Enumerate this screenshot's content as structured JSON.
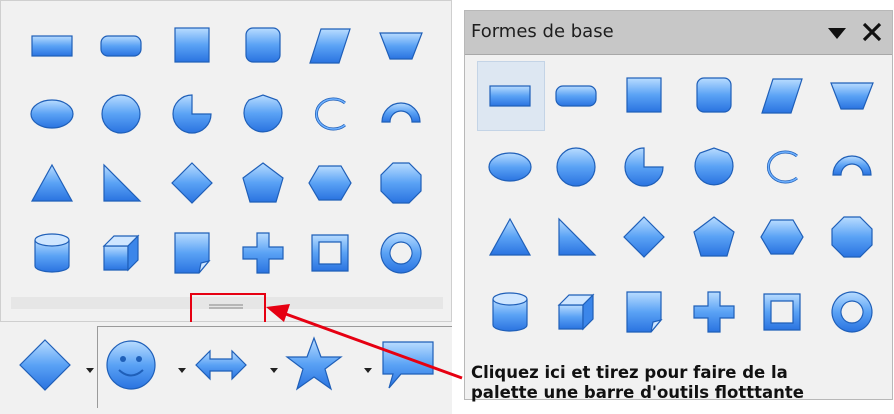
{
  "floating_palette": {
    "title": "Formes de base",
    "menu_icon": "triangle-down-icon",
    "close_icon": "close-icon"
  },
  "shapes": [
    "rectangle",
    "rounded-rectangle",
    "square",
    "rounded-square",
    "parallelogram",
    "trapezoid",
    "ellipse",
    "circle",
    "circle-pie",
    "circle-segment",
    "arc",
    "block-arc",
    "isosceles-triangle",
    "right-triangle",
    "diamond",
    "pentagon",
    "hexagon",
    "octagon",
    "cylinder",
    "cube",
    "folded-corner",
    "cross",
    "frame",
    "ring"
  ],
  "bottom_toolbar": [
    "diamond",
    "smiley",
    "left-right-arrow",
    "star",
    "callout"
  ],
  "colors": {
    "shape_fill_light": "#a9d1ff",
    "shape_fill_dark": "#2f7fe8",
    "shape_stroke": "#1f5fb8",
    "highlight": "#e60012"
  },
  "callout_text": {
    "line1": "Cliquez ici et tirez pour faire de la",
    "line2": "palette une barre d'outils flotttante"
  }
}
